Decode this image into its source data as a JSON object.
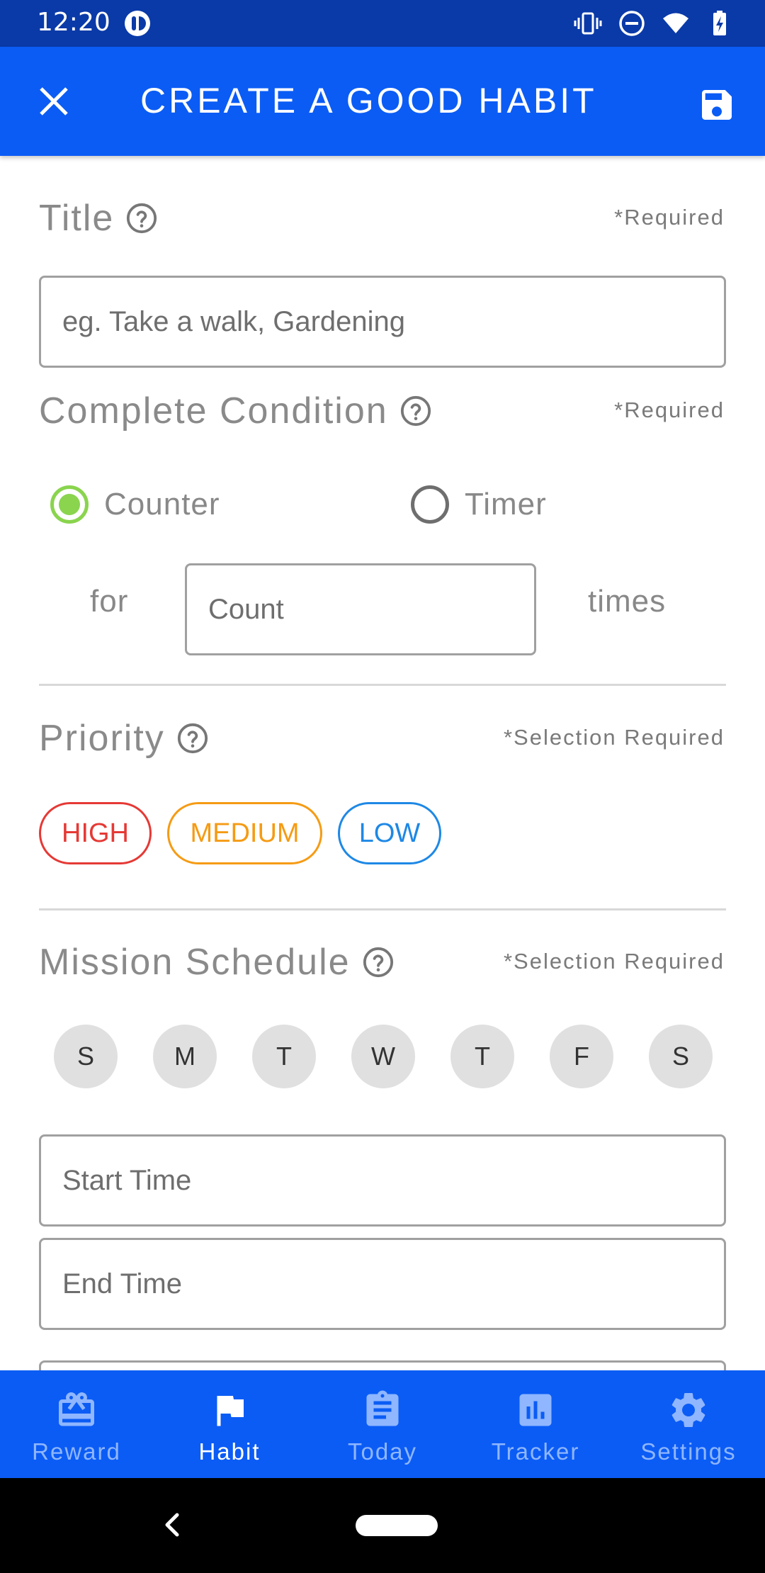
{
  "status_bar": {
    "time": "12:20",
    "icons": [
      "app-notification-icon",
      "vibrate-icon",
      "do-not-disturb-icon",
      "wifi-icon",
      "battery-charging-icon"
    ]
  },
  "app_bar": {
    "title": "CREATE A GOOD HABIT",
    "close_icon": "close-icon",
    "save_icon": "save-icon",
    "background_color": "#0b5cf5"
  },
  "form": {
    "title_section": {
      "label": "Title",
      "required": "*Required",
      "input_placeholder": "eg. Take a walk, Gardening",
      "input_value": ""
    },
    "complete_condition": {
      "label": "Complete Condition",
      "required": "*Required",
      "options": [
        {
          "label": "Counter",
          "checked": true
        },
        {
          "label": "Timer",
          "checked": false
        }
      ],
      "for_label": "for",
      "count_placeholder": "Count",
      "count_value": "",
      "times_label": "times"
    },
    "priority": {
      "label": "Priority",
      "required": "*Selection Required",
      "chips": [
        {
          "label": "HIGH",
          "color": "#e53935"
        },
        {
          "label": "MEDIUM",
          "color": "#f59b14"
        },
        {
          "label": "LOW",
          "color": "#1e88e5"
        }
      ]
    },
    "mission_schedule": {
      "label": "Mission Schedule",
      "required": "*Selection Required",
      "days": [
        "S",
        "M",
        "T",
        "W",
        "T",
        "F",
        "S"
      ],
      "start_time_placeholder": "Start Time",
      "end_time_placeholder": "End Time"
    }
  },
  "bottom_nav": {
    "items": [
      {
        "label": "Reward",
        "icon": "gift-card-icon",
        "active": false
      },
      {
        "label": "Habit",
        "icon": "flag-icon",
        "active": true
      },
      {
        "label": "Today",
        "icon": "clipboard-icon",
        "active": false
      },
      {
        "label": "Tracker",
        "icon": "bar-chart-icon",
        "active": false
      },
      {
        "label": "Settings",
        "icon": "gear-icon",
        "active": false
      }
    ]
  },
  "colors": {
    "accent": "#0b5cf5",
    "status_bar": "#0a3aa8",
    "radio_checked": "#8ad44e"
  }
}
